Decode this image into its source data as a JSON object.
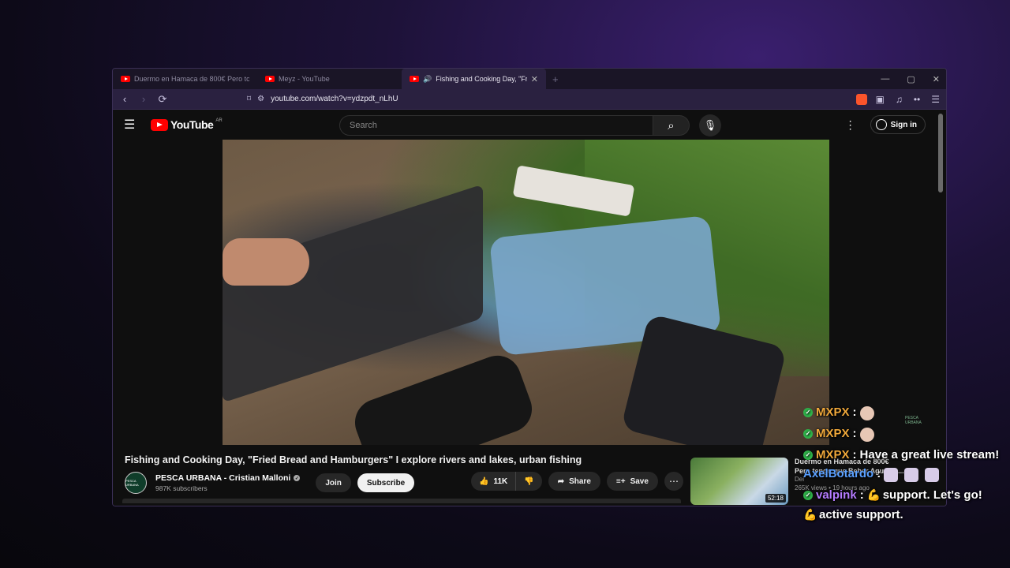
{
  "browser": {
    "tabs": [
      {
        "title": "Duermo en Hamaca de 800€ Pero tc",
        "active": false
      },
      {
        "title": "Meyz - YouTube",
        "active": false
      },
      {
        "title": "Fishing and Cooking Day, \"Fri",
        "active": true
      }
    ],
    "new_tab": "+",
    "url": "youtube.com/watch?v=ydzpdt_nLhU"
  },
  "youtube": {
    "logo_text": "YouTube",
    "region": "AR",
    "search_placeholder": "Search",
    "signin_label": "Sign in",
    "video": {
      "title": "Fishing and Cooking Day, \"Fried Bread and Hamburgers\" I explore rivers and lakes, urban fishing",
      "channel": "PESCA URBANA - Cristian Malloni",
      "subscribers": "987K subscribers",
      "join_label": "Join",
      "subscribe_label": "Subscribe",
      "likes": "11K",
      "share_label": "Share",
      "save_label": "Save"
    },
    "recommended": {
      "title_line1": "Duermo en Hamaca de 800€",
      "title_line2": "Pero tengo que Beber Agua co...",
      "channel": "Dei",
      "meta": "265K views • 19 hours ago",
      "duration": "52:18"
    }
  },
  "chat": {
    "messages": [
      {
        "user": "MXPX",
        "text": ""
      },
      {
        "user": "MXPX",
        "text": ""
      },
      {
        "user": "MXPX",
        "text": "Have a great live stream!"
      },
      {
        "user": "AxelBotardo",
        "text": ""
      },
      {
        "user": "valpink",
        "text": "support. Let's go!"
      },
      {
        "user": "",
        "text": "active support."
      }
    ],
    "watermark": "PESCA URBANA"
  },
  "colors": {
    "accent_red": "#ff0000",
    "mxpx": "#f0a83a",
    "axel": "#5aa0ff",
    "valpink": "#b57cff",
    "badge_green": "#2fb34a"
  }
}
